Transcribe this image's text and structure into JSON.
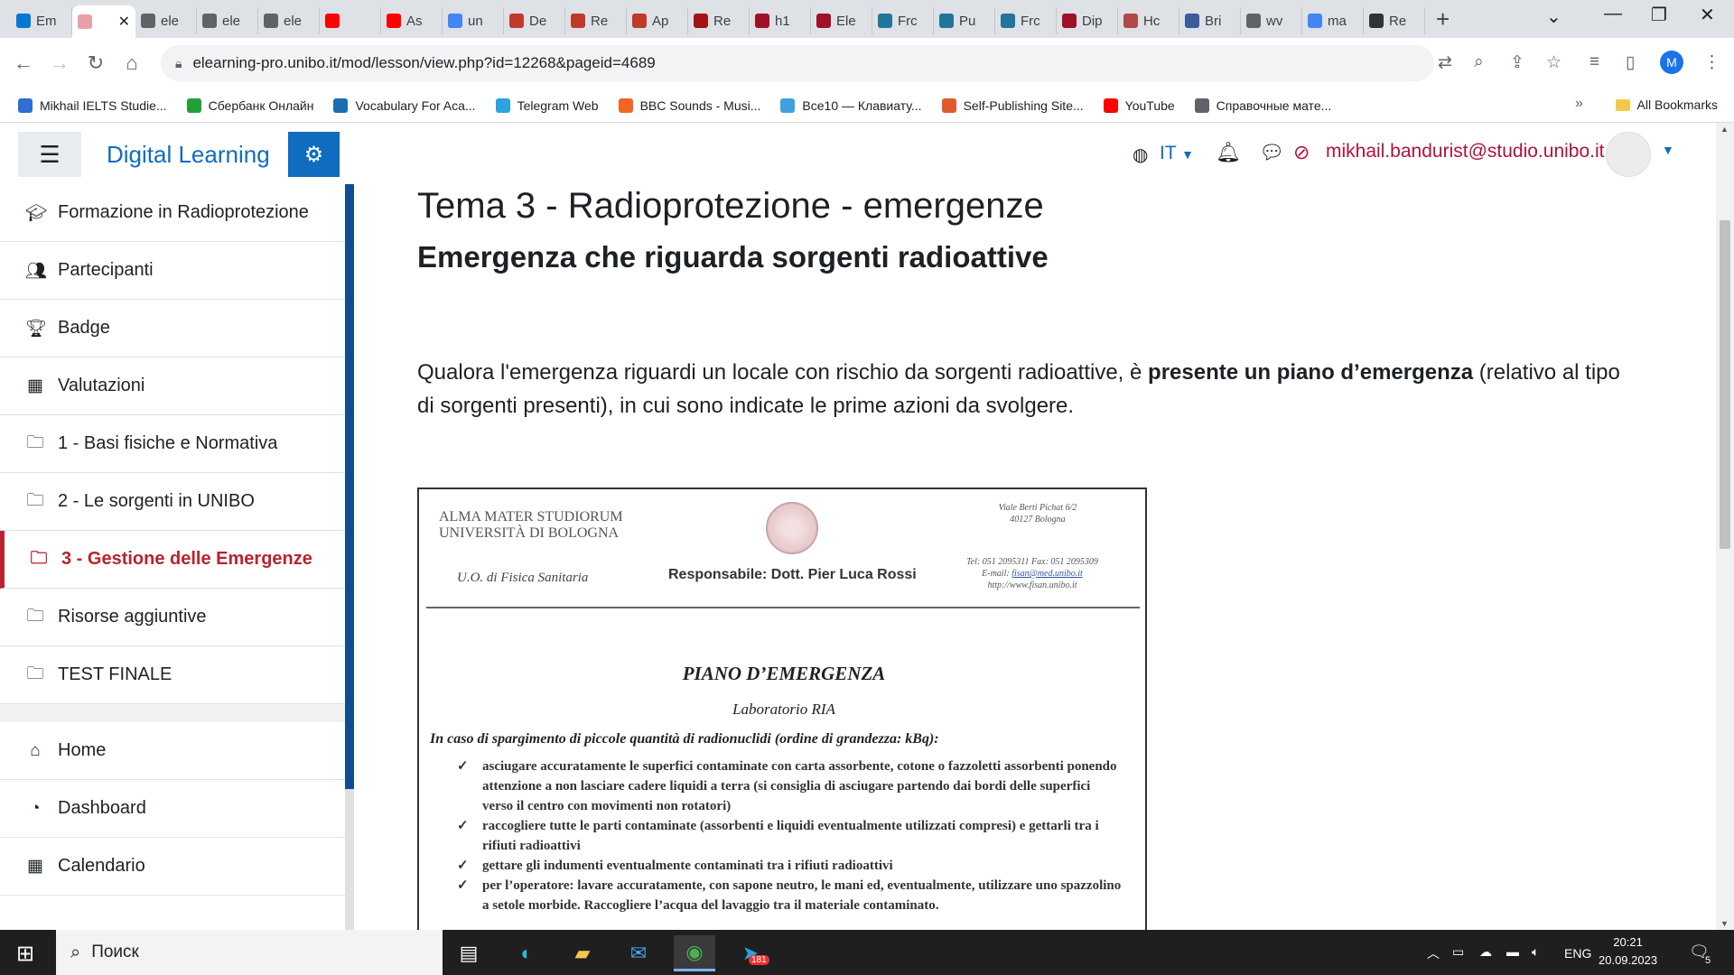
{
  "browser": {
    "tabs": [
      {
        "label": "Em",
        "icon": "outlook-icon",
        "color": "#0078d4"
      },
      {
        "label": "",
        "icon": "unibo-icon",
        "color": "#e8a0a8",
        "active": true
      },
      {
        "label": "ele",
        "icon": "globe-icon",
        "color": "#5f6368"
      },
      {
        "label": "ele",
        "icon": "globe-icon",
        "color": "#5f6368"
      },
      {
        "label": "ele",
        "icon": "globe-icon",
        "color": "#5f6368"
      },
      {
        "label": "",
        "icon": "youtube-icon",
        "color": "#ff0000"
      },
      {
        "label": "As",
        "icon": "youtube-icon",
        "color": "#ff0000"
      },
      {
        "label": "un",
        "icon": "google-icon",
        "color": "#4285f4"
      },
      {
        "label": "De",
        "icon": "unibo-icon",
        "color": "#c0392b"
      },
      {
        "label": "Re",
        "icon": "unibo-icon",
        "color": "#c0392b"
      },
      {
        "label": "Ap",
        "icon": "unibo-icon",
        "color": "#c0392b"
      },
      {
        "label": "Re",
        "icon": "researchgate-icon",
        "color": "#a31515"
      },
      {
        "label": "h1",
        "icon": "shield-icon",
        "color": "#a01028"
      },
      {
        "label": "Ele",
        "icon": "shield-icon",
        "color": "#a01028"
      },
      {
        "label": "Frc",
        "icon": "wordpress-icon",
        "color": "#21759b"
      },
      {
        "label": "Pu",
        "icon": "wordpress-icon",
        "color": "#21759b"
      },
      {
        "label": "Frc",
        "icon": "wordpress-icon",
        "color": "#21759b"
      },
      {
        "label": "Dip",
        "icon": "shield-icon",
        "color": "#a01028"
      },
      {
        "label": "Hc",
        "icon": "puzzle-icon",
        "color": "#b04a4a"
      },
      {
        "label": "Bri",
        "icon": "doc-icon",
        "color": "#3b5b9a"
      },
      {
        "label": "wv",
        "icon": "globe-icon",
        "color": "#5f6368"
      },
      {
        "label": "ma",
        "icon": "google-icon",
        "color": "#4285f4"
      },
      {
        "label": "Re",
        "icon": "r-icon",
        "color": "#333333"
      }
    ],
    "url": "elearning-pro.unibo.it/mod/lesson/view.php?id=12268&pageid=4689",
    "profile_initial": "M",
    "bookmarks": [
      {
        "label": "Mikhail IELTS Studie...",
        "icon": "doc-icon",
        "color": "#2f6fd1"
      },
      {
        "label": "Сбербанк Онлайн",
        "icon": "sber-icon",
        "color": "#21a038"
      },
      {
        "label": "Vocabulary For Aca...",
        "icon": "ielts-icon",
        "color": "#1b6fb0"
      },
      {
        "label": "Telegram Web",
        "icon": "telegram-icon",
        "color": "#2aa3e0"
      },
      {
        "label": "BBC Sounds - Musi...",
        "icon": "bbc-icon",
        "color": "#f26522"
      },
      {
        "label": "Все10 — Клавиату...",
        "icon": "keyboard-icon",
        "color": "#3fa0e0"
      },
      {
        "label": "Self-Publishing Site...",
        "icon": "p-icon",
        "color": "#e05a2b"
      },
      {
        "label": "YouTube",
        "icon": "youtube-icon",
        "color": "#ff0000"
      },
      {
        "label": "Справочные мате...",
        "icon": "globe-icon",
        "color": "#5f6368"
      }
    ],
    "all_bookmarks": "All Bookmarks"
  },
  "moodle": {
    "site_name": "Digital Learning",
    "lang": "IT",
    "user_email": "mikhail.bandurist@studio.unibo.it",
    "sidebar": [
      {
        "label": "Formazione in Radioprotezione",
        "icon": "graduation-cap-icon"
      },
      {
        "label": "Partecipanti",
        "icon": "users-icon"
      },
      {
        "label": "Badge",
        "icon": "trophy-icon"
      },
      {
        "label": "Valutazioni",
        "icon": "table-icon"
      },
      {
        "label": "1 - Basi fisiche e Normativa",
        "icon": "folder-icon"
      },
      {
        "label": "2 - Le sorgenti in UNIBO",
        "icon": "folder-icon"
      },
      {
        "label": "3 - Gestione delle Emergenze",
        "icon": "folder-icon",
        "active": true
      },
      {
        "label": "Risorse aggiuntive",
        "icon": "folder-icon"
      },
      {
        "label": "TEST FINALE",
        "icon": "folder-icon"
      },
      {
        "label": "Home",
        "icon": "home-icon"
      },
      {
        "label": "Dashboard",
        "icon": "dashboard-icon"
      },
      {
        "label": "Calendario",
        "icon": "calendar-icon"
      }
    ]
  },
  "lesson": {
    "title": "Tema 3 - Radioprotezione - emergenze",
    "subtitle": "Emergenza che riguarda sorgenti radioattive",
    "para_pre": "Qualora l'emergenza riguardi un locale con rischio da sorgenti radioattive, è ",
    "para_bold": "presente un piano d’emergenza",
    "para_post": " (relativo al tipo di sorgenti presenti), in cui sono indicate le prime azioni da svolgere.",
    "doc": {
      "header_left": "ALMA MATER STUDIORUM\nUNIVERSITÀ DI BOLOGNA",
      "uo": "U.O. di Fisica Sanitaria",
      "responsabile": "Responsabile: Dott. Pier Luca Rossi",
      "address": "Viale Berti Pichat 6/2\n40127 Bologna",
      "tel": "Tel: 051 2095311  Fax: 051 2095309",
      "email_label": "E-mail: ",
      "email": "fisan@med.unibo.it",
      "web": "http://www.fisan.unibo.it",
      "title": "PIANO D’EMERGENZA",
      "lab": "Laboratorio RIA",
      "intro": "In caso di spargimento di piccole quantità di radionuclidi (ordine di grandezza: kBq):",
      "items": [
        "asciugare accuratamente le superfici contaminate con carta assorbente, cotone o fazzoletti assorbenti ponendo attenzione a non lasciare cadere liquidi a terra (si consiglia di asciugare partendo dai bordi delle superfici verso il centro con movimenti non rotatori)",
        "raccogliere tutte le parti contaminate (assorbenti e liquidi eventualmente utilizzati compresi) e gettarli tra i rifiuti radioattivi",
        "gettare gli indumenti eventualmente contaminati tra i rifiuti radioattivi",
        "per l’operatore: lavare accuratamente, con sapone neutro, le mani ed, eventualmente, utilizzare uno spazzolino a setole morbide. Raccogliere l’acqua del lavaggio tra il materiale contaminato."
      ]
    }
  },
  "taskbar": {
    "search": "Поиск",
    "lang": "ENG",
    "time": "20:21",
    "date": "20.09.2023",
    "telegram_badge": "181",
    "notifications": "5"
  }
}
